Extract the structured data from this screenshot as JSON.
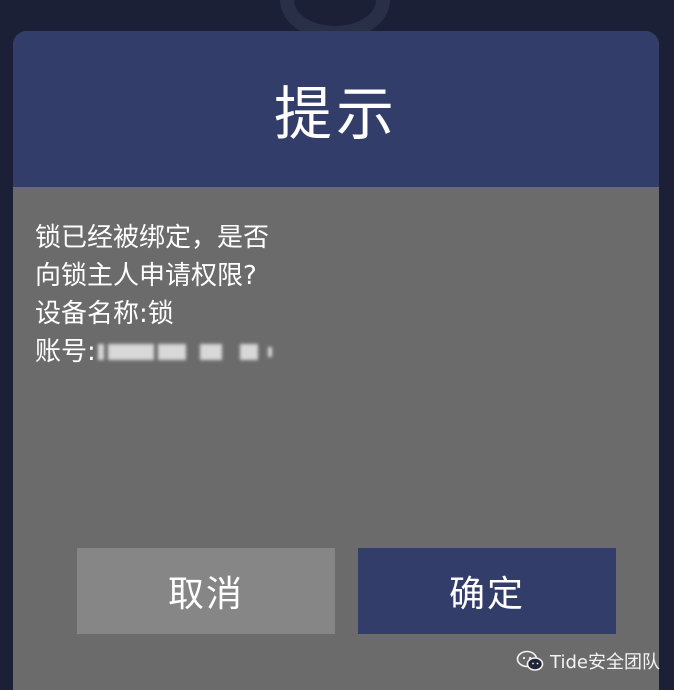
{
  "dialog": {
    "title": "提示",
    "message_lines": [
      "锁已经被绑定，是否",
      "向锁主人申请权限?",
      "设备名称:锁"
    ],
    "account_label": "账号:",
    "account_value_redacted": true
  },
  "buttons": {
    "cancel_label": "取消",
    "confirm_label": "确定"
  },
  "watermark": {
    "icon": "wechat-icon",
    "text": "Tide安全团队"
  },
  "colors": {
    "background": "#1c2036",
    "header": "#323d6a",
    "body": "#6b6b6b",
    "cancel_button": "#868686",
    "confirm_button": "#323d6a"
  }
}
